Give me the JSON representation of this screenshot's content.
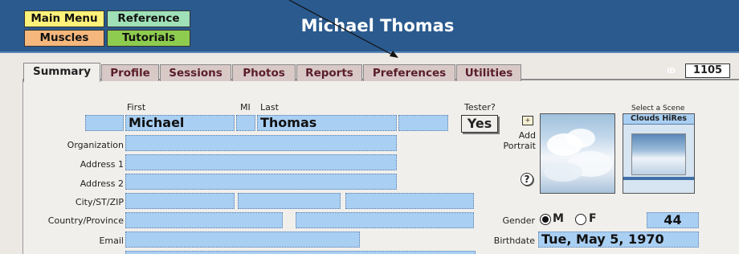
{
  "nav": {
    "main_menu": "Main Menu",
    "reference": "Reference",
    "muscles": "Muscles",
    "tutorials": "Tutorials"
  },
  "title": "Michael Thomas",
  "tabs": [
    {
      "label": "Summary",
      "active": true
    },
    {
      "label": "Profile"
    },
    {
      "label": "Sessions"
    },
    {
      "label": "Photos"
    },
    {
      "label": "Reports"
    },
    {
      "label": "Preferences"
    },
    {
      "label": "Utilities"
    }
  ],
  "id": {
    "label": "ID",
    "value": "1105"
  },
  "labels": {
    "first": "First",
    "mi": "MI",
    "last": "Last",
    "tester": "Tester?",
    "organization": "Organization",
    "address1": "Address 1",
    "address2": "Address 2",
    "city": "City/ST/ZIP",
    "country": "Country/Province",
    "email": "Email",
    "add_portrait_1": "Add",
    "add_portrait_2": "Portrait",
    "select_scene": "Select a Scene",
    "gender": "Gender",
    "birthdate": "Birthdate",
    "male": "M",
    "female": "F"
  },
  "fields": {
    "first": "Michael",
    "last": "Thomas",
    "tester": "Yes",
    "age": "44",
    "birthdate": "Tue, May 5, 1970",
    "gender": "M"
  },
  "scene": {
    "name": "Clouds HiRes"
  },
  "colors": {
    "header": "#2a5a8e",
    "field": "#a9cff3",
    "main_menu": "#fff27a",
    "reference": "#9fe0b8",
    "muscles": "#f6b77d",
    "tutorials": "#8ecc4f",
    "tab": "#d8c9c7"
  }
}
